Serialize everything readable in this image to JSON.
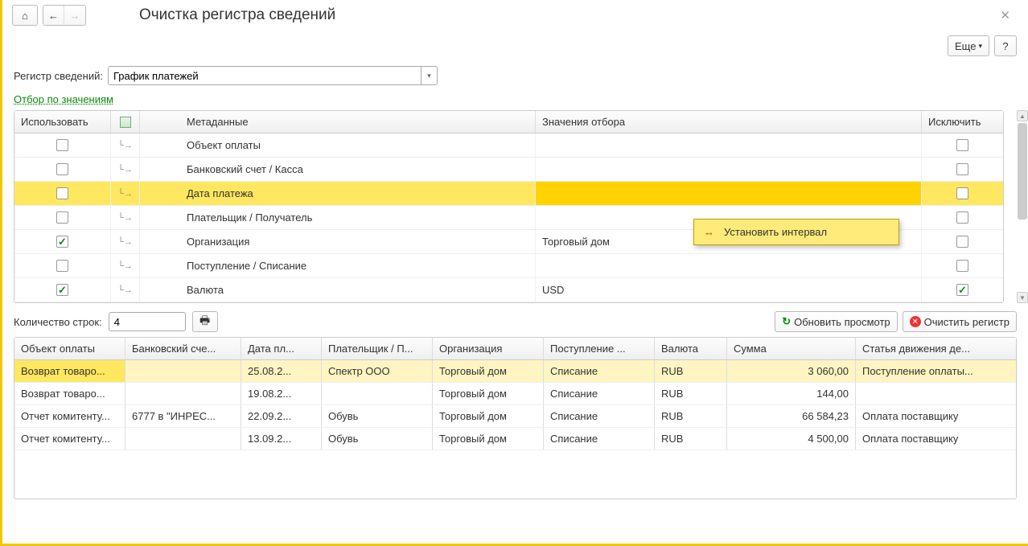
{
  "header": {
    "title": "Очистка регистра сведений"
  },
  "topRight": {
    "more": "Еще",
    "help": "?"
  },
  "form": {
    "registerLabel": "Регистр сведений:",
    "registerValue": "График платежей",
    "filterLink": "Отбор по значениям"
  },
  "filterGrid": {
    "headers": {
      "use": "Использовать",
      "meta": "Метаданные",
      "vals": "Значения отбора",
      "excl": "Исключить"
    },
    "rows": [
      {
        "use": false,
        "meta": "Объект оплаты",
        "val": "",
        "excl": false,
        "sel": false
      },
      {
        "use": false,
        "meta": "Банковский счет / Касса",
        "val": "",
        "excl": false,
        "sel": false
      },
      {
        "use": false,
        "meta": "Дата платежа",
        "val": "",
        "excl": false,
        "sel": true
      },
      {
        "use": false,
        "meta": "Плательщик / Получатель",
        "val": "",
        "excl": false,
        "sel": false
      },
      {
        "use": true,
        "meta": "Организация",
        "val": "Торговый дом",
        "excl": false,
        "sel": false
      },
      {
        "use": false,
        "meta": "Поступление / Списание",
        "val": "",
        "excl": false,
        "sel": false
      },
      {
        "use": true,
        "meta": "Валюта",
        "val": "USD",
        "excl": true,
        "sel": false
      }
    ]
  },
  "contextMenu": {
    "item": "Установить интервал"
  },
  "mid": {
    "rowCountLabel": "Количество строк:",
    "rowCount": "4",
    "refresh": "Обновить просмотр",
    "clear": "Очистить регистр"
  },
  "dataGrid": {
    "headers": {
      "c0": "Объект оплаты",
      "c1": "Банковский сче...",
      "c2": "Дата пл...",
      "c3": "Плательщик / П...",
      "c4": "Организация",
      "c5": "Поступление ...",
      "c6": "Валюта",
      "c7": "Сумма",
      "c8": "Статья движения де..."
    },
    "rows": [
      {
        "c0": "Возврат товаро...",
        "c1": "",
        "c2": "25.08.2...",
        "c3": "Спектр ООО",
        "c4": "Торговый дом",
        "c5": "Списание",
        "c6": "RUB",
        "c7": "3 060,00",
        "c8": "Поступление оплаты...",
        "sel": true
      },
      {
        "c0": "Возврат товаро...",
        "c1": "",
        "c2": "19.08.2...",
        "c3": "",
        "c4": "Торговый дом",
        "c5": "Списание",
        "c6": "RUB",
        "c7": "144,00",
        "c8": "",
        "sel": false
      },
      {
        "c0": "Отчет комитенту...",
        "c1": "6777 в \"ИНРЕС...",
        "c2": "22.09.2...",
        "c3": "Обувь",
        "c4": "Торговый дом",
        "c5": "Списание",
        "c6": "RUB",
        "c7": "66 584,23",
        "c8": "Оплата поставщику",
        "sel": false
      },
      {
        "c0": "Отчет комитенту...",
        "c1": "",
        "c2": "13.09.2...",
        "c3": "Обувь",
        "c4": "Торговый дом",
        "c5": "Списание",
        "c6": "RUB",
        "c7": "4 500,00",
        "c8": "Оплата поставщику",
        "sel": false
      }
    ]
  }
}
